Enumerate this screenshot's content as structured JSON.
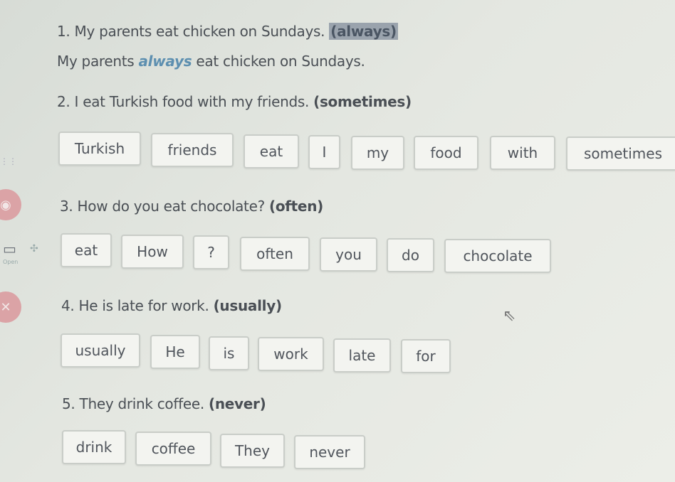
{
  "q1": {
    "number": "1.",
    "text": "My parents eat chicken on Sundays.",
    "adverb": "(always)",
    "answer_before": "My parents ",
    "answer_adverb": "always",
    "answer_after": " eat chicken on Sundays."
  },
  "q2": {
    "number": "2.",
    "text": "I eat Turkish food with my friends.",
    "adverb": "(sometimes)",
    "chips": [
      "Turkish",
      "friends",
      "eat",
      "I",
      "my",
      "food",
      "with",
      "sometimes"
    ]
  },
  "q3": {
    "number": "3.",
    "text": "How do you eat chocolate?",
    "adverb": "(often)",
    "chips": [
      "eat",
      "How",
      "?",
      "often",
      "you",
      "do",
      "chocolate"
    ]
  },
  "q4": {
    "number": "4.",
    "text": "He is late for work.",
    "adverb": "(usually)",
    "chips": [
      "usually",
      "He",
      "is",
      "work",
      "late",
      "for"
    ]
  },
  "q5": {
    "number": "5.",
    "text": "They drink coffee.",
    "adverb": "(never)",
    "chips": [
      "drink",
      "coffee",
      "They",
      "never"
    ]
  },
  "sidebar": {
    "open_label": "Open",
    "colors": {
      "red": "#dba3a6",
      "highlight": "#9aa3ad",
      "accent": "#5d8fb0"
    }
  }
}
